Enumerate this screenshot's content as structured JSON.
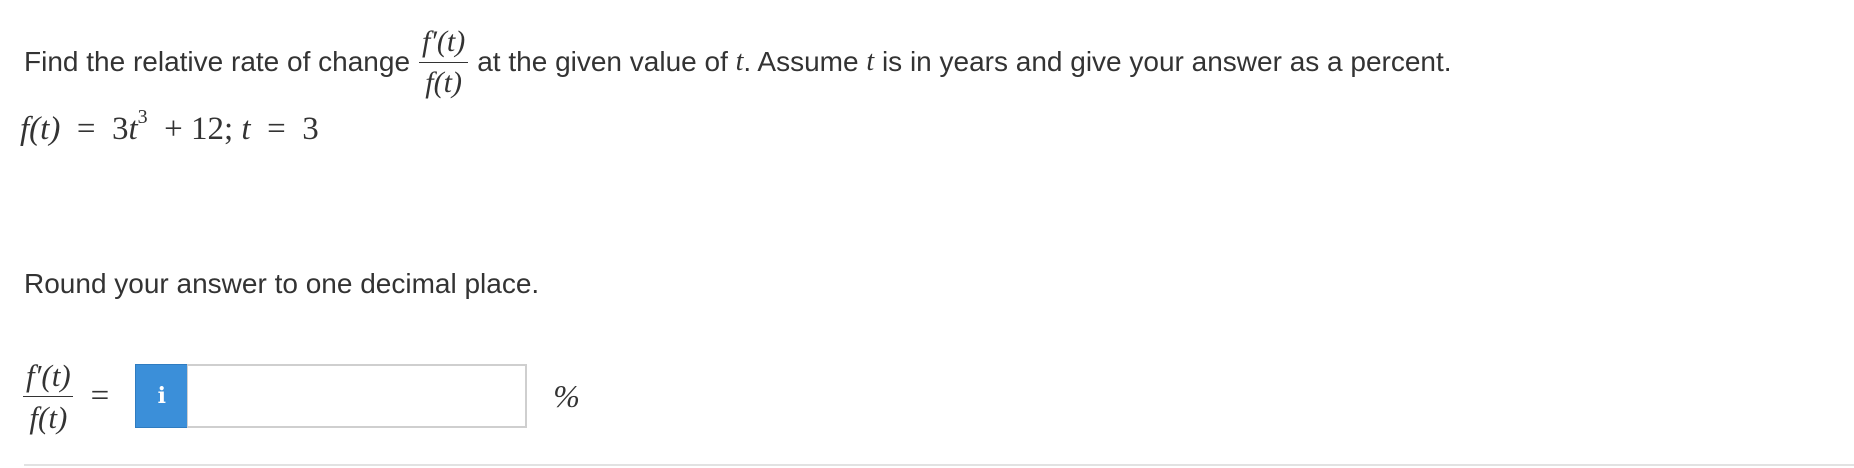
{
  "question": {
    "intro": "Find the relative rate of change",
    "frac_num": "f′(t)",
    "frac_den": "f(t)",
    "after_pre": "at the given value of",
    "var_t": "t",
    "after_mid": ". Assume",
    "after_post": "is in years and give your answer as a percent."
  },
  "function": {
    "lhs": "f(t)",
    "eq": "=",
    "coef": "3",
    "var": "t",
    "exp": "3",
    "rest": "+ 12;",
    "t_var": "t",
    "t_eq": "=",
    "t_val": "3"
  },
  "instruction": "Round your answer to one decimal place.",
  "answer": {
    "frac_num": "f′(t)",
    "frac_den": "f(t)",
    "equals": "=",
    "info_icon": "i",
    "input_value": "",
    "unit": "%"
  }
}
